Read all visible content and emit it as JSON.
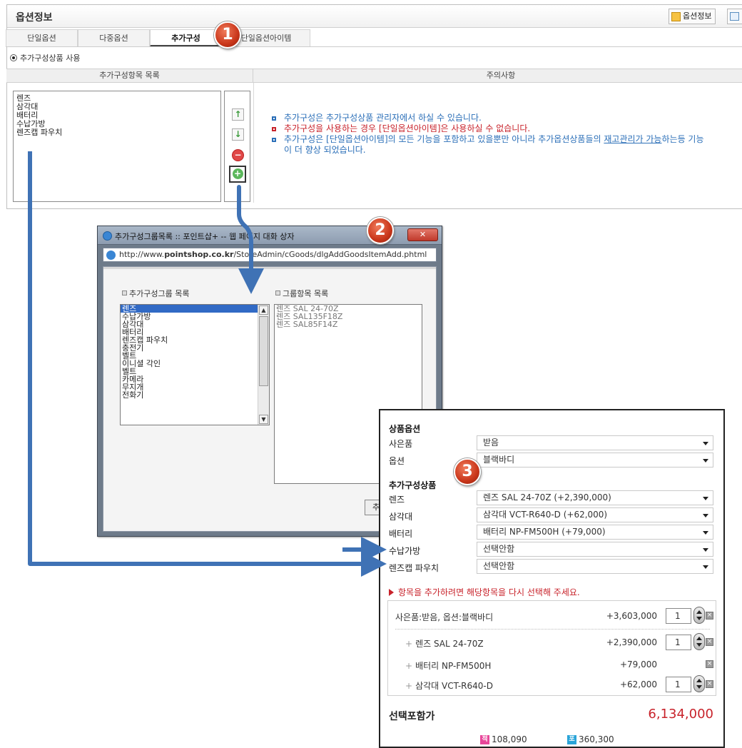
{
  "panel": {
    "title": "옵션정보",
    "header_btn1": "옵션정보",
    "tabs": [
      "단일옵션",
      "다중옵션",
      "추가구성",
      "단일옵션아이템"
    ],
    "radio_label": "추가구성상품 사용",
    "col_left": "추가구성항목 목록",
    "col_right": "주의사항",
    "items": [
      "렌즈",
      "삼각대",
      "배터리",
      "수납가방",
      "렌즈캡 파우치"
    ],
    "notes": {
      "n1": "추가구성은 추가구성상품 관리자에서 하실 수 있습니다.",
      "n2": "추가구성을 사용하는 경우 [단일옵션아이템]은 사용하실 수 없습니다.",
      "n3a": "추가구성은 [단일옵션아이템]의 모든 기능을 포함하고 있을뿐만 아니라 추가옵션상품들의 ",
      "n3u": "재고관리가 가능",
      "n3b": "하는등 기능",
      "n3c": "이 더 향상 되었습니다."
    }
  },
  "dialog": {
    "title": "추가구성그룹목록 :: 포인트샵+ -- 웹 페이지 대화 상자",
    "url_pre": "http://www.",
    "url_host": "pointshop.co.kr",
    "url_path": "/StoreAdmin/cGoods/dlgAddGoodsItemAdd.phtml",
    "left_label": "추가구성그룹 목록",
    "right_label": "그룹항목 목록",
    "groups": [
      "렌즈",
      "수납가방",
      "삼각대",
      "배터리",
      "렌즈캡 파우치",
      "충전기",
      "벨트",
      "이니셜 각인",
      "벨트",
      "카메라",
      "무지개",
      "전화기"
    ],
    "group_items": [
      "렌즈 SAL 24-70Z",
      "렌즈 SAL135F18Z",
      "렌즈 SAL85F14Z"
    ],
    "button": "추가"
  },
  "badges": [
    "1",
    "2",
    "3"
  ],
  "card": {
    "section1": "상품옵션",
    "gift_label": "사은품",
    "gift_value": "받음",
    "option_label": "옵션",
    "option_value": "블랙바디",
    "section2": "추가구성상품",
    "rows": [
      {
        "label": "렌즈",
        "value": "렌즈 SAL 24-70Z (+2,390,000)"
      },
      {
        "label": "삼각대",
        "value": "삼각대 VCT-R640-D (+62,000)"
      },
      {
        "label": "배터리",
        "value": "배터리 NP-FM500H (+79,000)"
      },
      {
        "label": "수납가방",
        "value": "선택안함"
      },
      {
        "label": "렌즈캡 파우치",
        "value": "선택안함"
      }
    ],
    "hint": "항목을 추가하려면 해당항목을 다시 선택해 주세요.",
    "summary": [
      {
        "name": "사은품:받음, 옵션:블랙바디",
        "price": "+3,603,000",
        "qty": "1"
      },
      {
        "name": "렌즈 SAL 24-70Z",
        "price": "+2,390,000",
        "qty": "1"
      },
      {
        "name": "배터리 NP-FM500H",
        "price": "+79,000"
      },
      {
        "name": "삼각대 VCT-R640-D",
        "price": "+62,000",
        "qty": "1"
      }
    ],
    "total_label": "선택포함가",
    "total_value": "6,134,000",
    "points": [
      {
        "icon": "적",
        "value": "108,090",
        "color": "#e8479a"
      },
      {
        "icon": "포",
        "value": "360,300",
        "color": "#2aa4d8"
      }
    ]
  },
  "colors": {
    "arrow": "#3f72b5",
    "accent_red": "#c8232b",
    "note_blue": "#2b6fb8"
  }
}
